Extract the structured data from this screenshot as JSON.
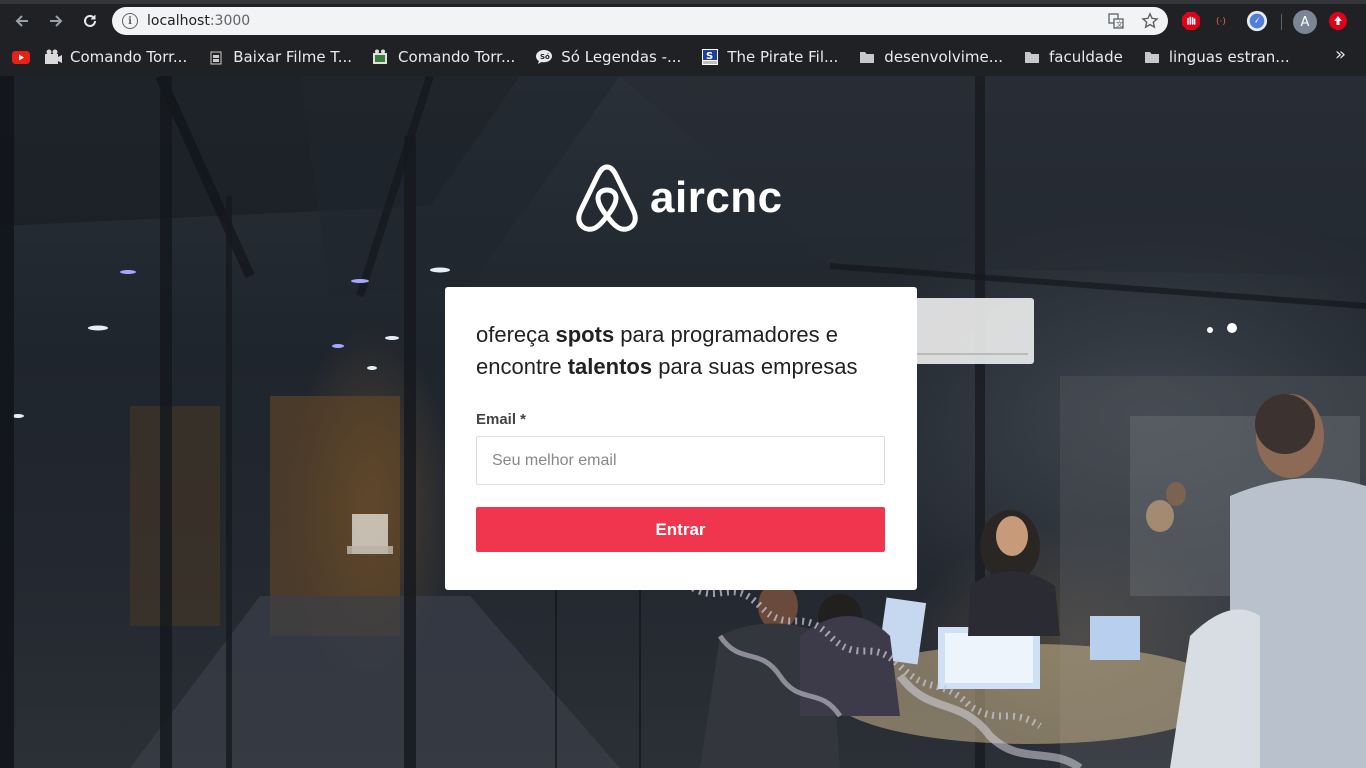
{
  "browser": {
    "url_host": "localhost",
    "url_port": ":3000",
    "profile_initial": "A",
    "bookmarks_overflow": "»",
    "bookmarks": [
      {
        "label": "",
        "icon": "youtube-icon"
      },
      {
        "label": "Comando Torr...",
        "icon": "film-icon"
      },
      {
        "label": "Baixar Filme T...",
        "icon": "film-reel-icon"
      },
      {
        "label": "Comando Torr...",
        "icon": "film-icon"
      },
      {
        "label": "Só Legendas -...",
        "icon": "speech-bubble-icon"
      },
      {
        "label": "The Pirate Fil...",
        "icon": "site-s-icon"
      },
      {
        "label": "desenvolvime...",
        "icon": "folder-icon"
      },
      {
        "label": "faculdade",
        "icon": "folder-icon"
      },
      {
        "label": "linguas estran...",
        "icon": "folder-icon"
      }
    ]
  },
  "app": {
    "logo_text": "aircnc",
    "headline": {
      "line1_pre": "ofereça ",
      "line1_bold": "spots",
      "line1_post": " para programadores e",
      "line2_pre": "encontre ",
      "line2_bold": "talentos",
      "line2_post": " para suas empresas"
    },
    "email_label": "Email *",
    "email_placeholder": "Seu melhor email",
    "submit_label": "Entrar"
  },
  "colors": {
    "accent": "#f0354f",
    "chrome_bg": "#202124",
    "omnibox_bg": "#f1f3f4"
  }
}
